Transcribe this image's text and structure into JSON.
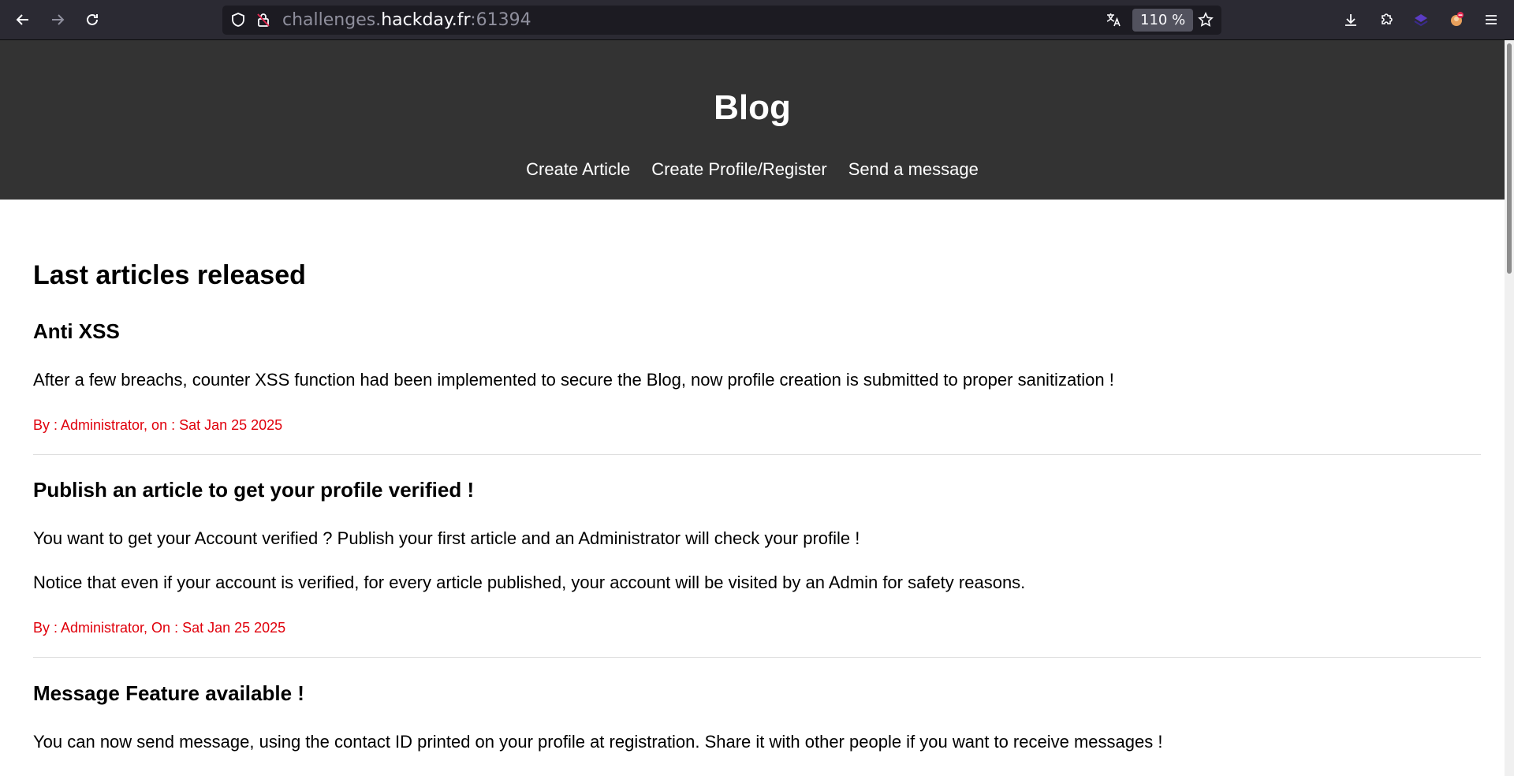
{
  "browser": {
    "url_prefix": "challenges.",
    "url_host": "hackday.fr",
    "url_port": ":61394",
    "zoom": "110 %"
  },
  "site": {
    "title": "Blog",
    "nav": [
      "Create Article",
      "Create Profile/Register",
      "Send a message"
    ]
  },
  "main": {
    "section_title": "Last articles released",
    "articles": [
      {
        "title": "Anti XSS",
        "paragraphs": [
          "After a few breachs, counter XSS function had been implemented to secure the Blog, now profile creation is submitted to proper sanitization !"
        ],
        "meta": "By : Administrator, on : Sat Jan 25 2025"
      },
      {
        "title": "Publish an article to get your profile verified !",
        "paragraphs": [
          "You want to get your Account verified ? Publish your first article and an Administrator will check your profile !",
          "Notice that even if your account is verified, for every article published, your account will be visited by an Admin for safety reasons."
        ],
        "meta": "By : Administrator, On : Sat Jan 25 2025"
      },
      {
        "title": "Message Feature available !",
        "paragraphs": [
          "You can now send message, using the contact ID printed on your profile at registration. Share it with other people if you want to receive messages !"
        ]
      }
    ]
  }
}
